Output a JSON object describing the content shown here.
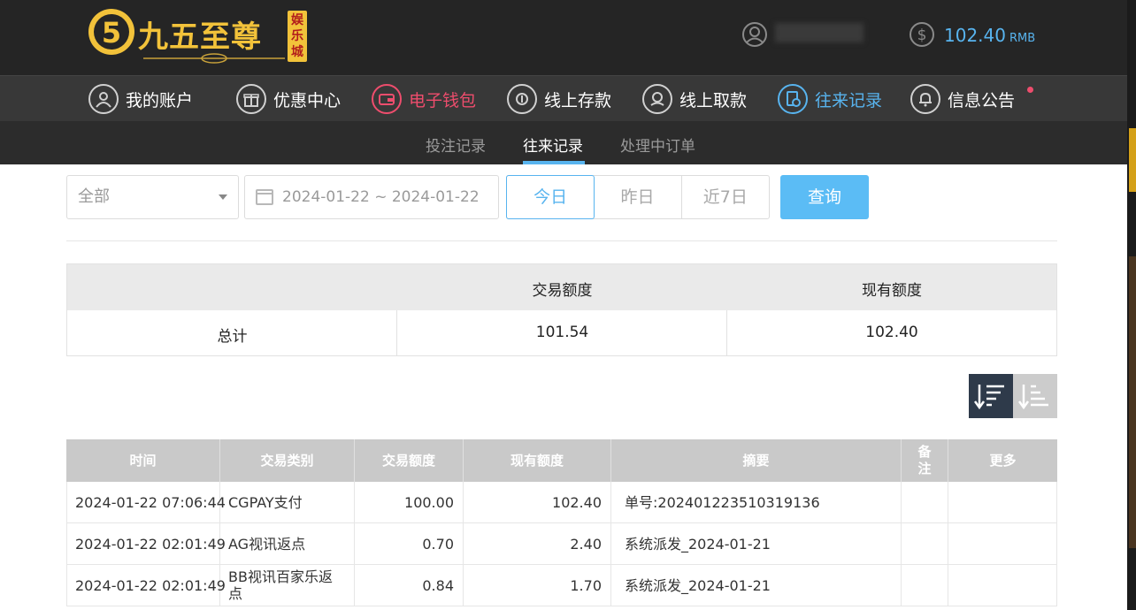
{
  "header": {
    "logo_text": "九五至尊",
    "logo_tag": "娱乐城",
    "balance_amount": "102.40",
    "balance_unit": "RMB"
  },
  "nav": {
    "items": [
      {
        "label": "我的账户"
      },
      {
        "label": "优惠中心"
      },
      {
        "label": "电子钱包"
      },
      {
        "label": "线上存款"
      },
      {
        "label": "线上取款"
      },
      {
        "label": "往来记录"
      },
      {
        "label": "信息公告"
      }
    ],
    "active_index": 5
  },
  "subnav": {
    "tabs": [
      {
        "label": "投注记录"
      },
      {
        "label": "往来记录"
      },
      {
        "label": "处理中订单"
      }
    ],
    "active_index": 1
  },
  "filters": {
    "type_select": "全部",
    "date_range": "2024-01-22 ~ 2024-01-22",
    "quick": [
      "今日",
      "昨日",
      "近7日"
    ],
    "quick_active_index": 0,
    "query_label": "查询"
  },
  "summary": {
    "headers": [
      "",
      "交易额度",
      "现有额度"
    ],
    "row_label": "总计",
    "transaction_total": "101.54",
    "current_balance": "102.40"
  },
  "table": {
    "headers": [
      "时间",
      "交易类别",
      "交易额度",
      "现有额度",
      "摘要",
      "备注",
      "更多"
    ],
    "rows": [
      {
        "time": "2024-01-22 07:06:44",
        "type": "CGPAY支付",
        "amount": "100.00",
        "balance": "102.40",
        "summary": "单号:202401223510319136",
        "note": "",
        "more": ""
      },
      {
        "time": "2024-01-22 02:01:49",
        "type": "AG视讯返点",
        "amount": "0.70",
        "balance": "2.40",
        "summary": "系统派发_2024-01-21",
        "note": "",
        "more": ""
      },
      {
        "time": "2024-01-22 02:01:49",
        "type": "BB视讯百家乐返点",
        "amount": "0.84",
        "balance": "1.70",
        "summary": "系统派发_2024-01-21",
        "note": "",
        "more": ""
      }
    ]
  },
  "colors": {
    "accent": "#58b4ef",
    "wallet": "#ee4d6d",
    "gold": "#f2c23a",
    "header_bg": "#252525"
  }
}
